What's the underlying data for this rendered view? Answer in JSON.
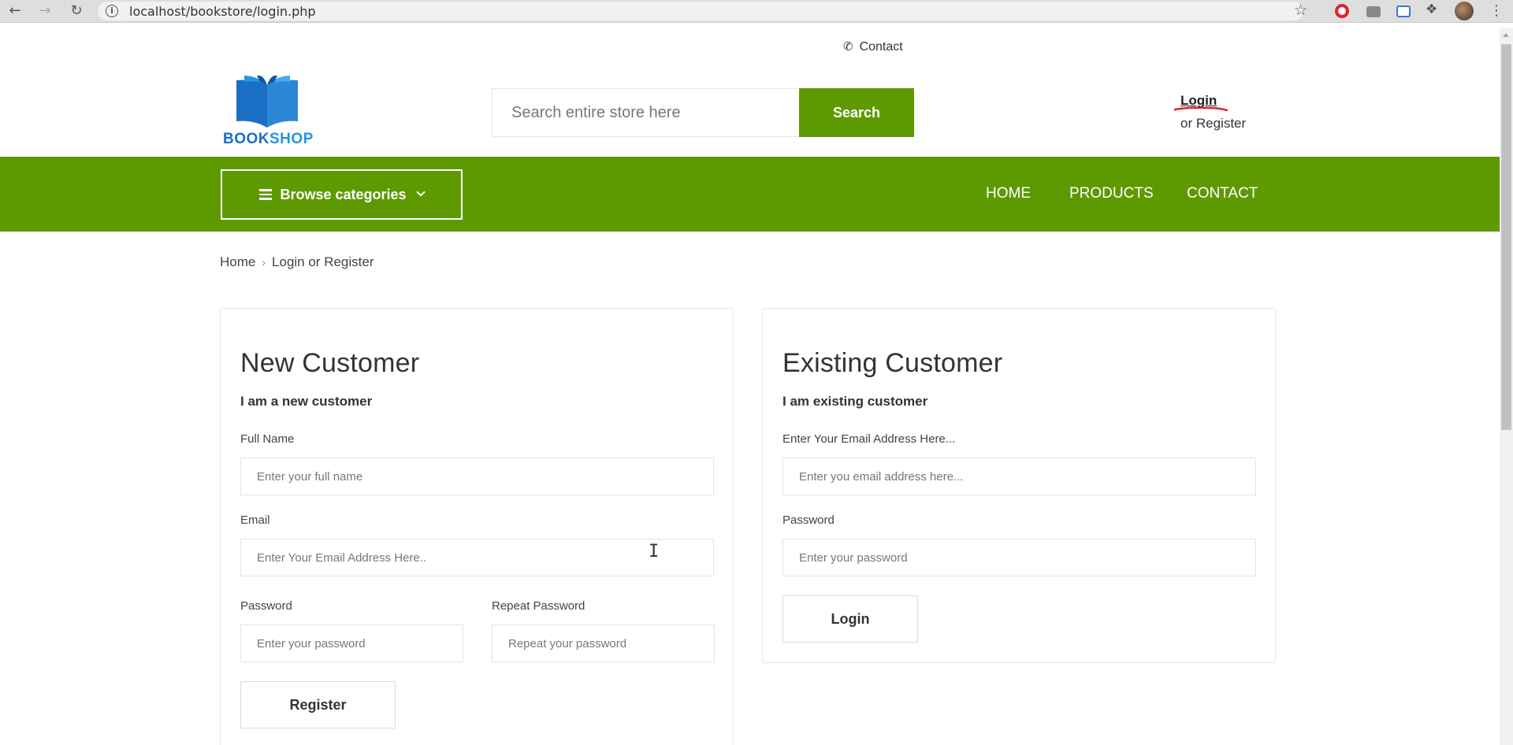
{
  "browser": {
    "url": "localhost/bookstore/login.php",
    "back_icon": "arrow-left-icon",
    "forward_icon": "arrow-right-icon",
    "reload_icon": "reload-icon"
  },
  "header": {
    "contact_label": "Contact",
    "logo": {
      "part1": "BOOK",
      "part2": "SHOP"
    },
    "search": {
      "placeholder": "Search entire store here",
      "button_label": "Search"
    },
    "account": {
      "login_label": "Login",
      "or_text": "or",
      "register_label": "Register"
    }
  },
  "nav": {
    "browse_label": "Browse categories",
    "links": [
      "HOME",
      "PRODUCTS",
      "CONTACT"
    ]
  },
  "breadcrumb": {
    "home": "Home",
    "current": "Login or Register"
  },
  "new_customer": {
    "title": "New Customer",
    "subtitle": "I am a new customer",
    "full_name": {
      "label": "Full Name",
      "placeholder": "Enter your full name"
    },
    "email": {
      "label": "Email",
      "placeholder": "Enter Your Email Address Here.."
    },
    "password": {
      "label": "Password",
      "placeholder": "Enter your password"
    },
    "repeat_password": {
      "label": "Repeat Password",
      "placeholder": "Repeat your password"
    },
    "register_button": "Register"
  },
  "existing_customer": {
    "title": "Existing Customer",
    "subtitle": "I am existing customer",
    "email": {
      "label": "Enter Your Email Address Here...",
      "placeholder": "Enter you email address here..."
    },
    "password": {
      "label": "Password",
      "placeholder": "Enter your password"
    },
    "login_button": "Login"
  },
  "colors": {
    "brand_green": "#5d9a02",
    "logo_blue": "#1a6ec3",
    "annotation_red": "#e0232b"
  }
}
